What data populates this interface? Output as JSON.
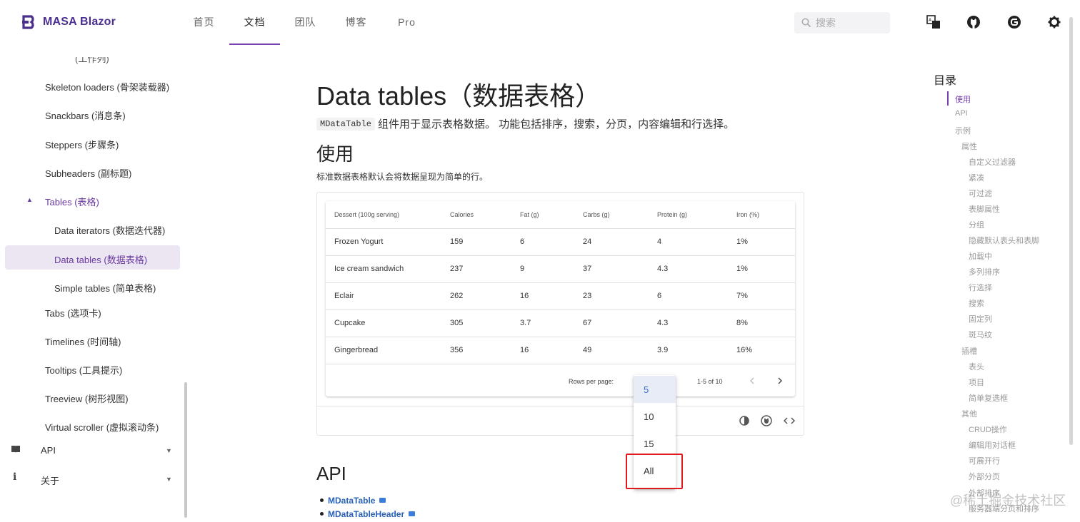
{
  "header": {
    "brand": "MASA Blazor",
    "nav": [
      "首页",
      "文档",
      "团队",
      "博客",
      "Pro"
    ],
    "active_nav": "文档",
    "search_placeholder": "搜索",
    "accent": "#7a3fb0"
  },
  "sidebar": {
    "cut_item": "(工作列)",
    "items": [
      "Skeleton loaders (骨架装载器)",
      "Snackbars (消息条)",
      "Steppers (步骤条)",
      "Subheaders (副标题)",
      "Tables (表格)",
      "Data iterators (数据迭代器)",
      "Data tables (数据表格)",
      "Simple tables (简单表格)",
      "Tabs (选项卡)",
      "Timelines (时间轴)",
      "Tooltips (工具提示)",
      "Treeview (树形视图)",
      "Virtual scroller (虚拟滚动条)"
    ],
    "groups": [
      "API",
      "关于"
    ]
  },
  "main": {
    "title": "Data tables（数据表格）",
    "intro_code": "MDataTable",
    "intro_text": "组件用于显示表格数据。 功能包括排序，搜索，分页，内容编辑和行选择。",
    "usage_heading": "使用",
    "usage_desc": "标准数据表格默认会将数据呈现为简单的行。",
    "api_heading": "API",
    "api_links": [
      "MDataTable",
      "MDataTableHeader"
    ]
  },
  "table": {
    "headers": [
      "Dessert (100g serving)",
      "Calories",
      "Fat (g)",
      "Carbs (g)",
      "Protein (g)",
      "Iron (%)"
    ],
    "rows": [
      [
        "Frozen Yogurt",
        "159",
        "6",
        "24",
        "4",
        "1%"
      ],
      [
        "Ice cream sandwich",
        "237",
        "9",
        "37",
        "4.3",
        "1%"
      ],
      [
        "Eclair",
        "262",
        "16",
        "23",
        "6",
        "7%"
      ],
      [
        "Cupcake",
        "305",
        "3.7",
        "67",
        "4.3",
        "8%"
      ],
      [
        "Gingerbread",
        "356",
        "16",
        "49",
        "3.9",
        "16%"
      ]
    ],
    "rows_per_page_label": "Rows per page:",
    "range": "1-5 of 10"
  },
  "menu": {
    "options": [
      "5",
      "10",
      "15",
      "All"
    ],
    "selected": "5",
    "highlighted": "All",
    "highlight_color": "#e0191f"
  },
  "toc": {
    "title": "目录",
    "items": [
      "使用",
      "API",
      "示例",
      "属性",
      "自定义过滤器",
      "紧凑",
      "可过滤",
      "表脚属性",
      "分组",
      "隐藏默认表头和表脚",
      "加载中",
      "多列排序",
      "行选择",
      "搜索",
      "固定列",
      "斑马纹",
      "插槽",
      "表头",
      "项目",
      "简单复选框",
      "其他",
      "CRUD操作",
      "编辑用对话框",
      "可展开行",
      "外部分页",
      "外部排序",
      "服务器端分页和排序"
    ]
  },
  "watermark": "@稀土掘金技术社区"
}
